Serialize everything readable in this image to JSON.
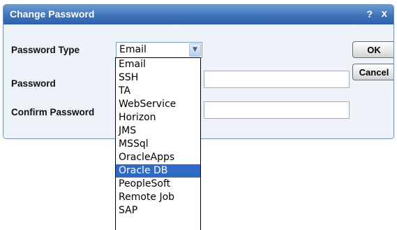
{
  "dialog": {
    "title": "Change Password",
    "help_glyph": "?",
    "close_glyph": "x"
  },
  "form": {
    "password_type_label": "Password Type",
    "password_label": "Password",
    "confirm_password_label": "Confirm Password",
    "password_type_value": "Email",
    "password_value": "",
    "confirm_password_value": ""
  },
  "buttons": {
    "ok_label": "OK",
    "cancel_label": "Cancel"
  },
  "dropdown": {
    "options": [
      "Email",
      "SSH",
      "TA",
      "WebService",
      "Horizon",
      "JMS",
      "MSSql",
      "OracleApps",
      "Oracle DB",
      "PeopleSoft",
      "Remote Job",
      "SAP"
    ],
    "highlighted": "Oracle DB"
  },
  "colors": {
    "titlebar": "#3e72b8",
    "highlight": "#316ac5",
    "dialog_background": "#eef3f9"
  }
}
